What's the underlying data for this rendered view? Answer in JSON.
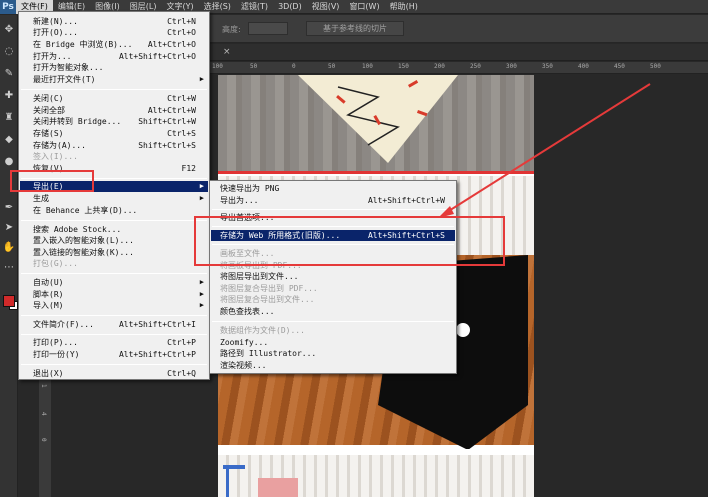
{
  "app": {
    "logo": "Ps"
  },
  "menubar": [
    {
      "label": "文件(F)",
      "active": true
    },
    {
      "label": "编辑(E)"
    },
    {
      "label": "图像(I)"
    },
    {
      "label": "图层(L)"
    },
    {
      "label": "文字(Y)"
    },
    {
      "label": "选择(S)"
    },
    {
      "label": "滤镜(T)"
    },
    {
      "label": "3D(D)"
    },
    {
      "label": "视图(V)"
    },
    {
      "label": "窗口(W)"
    },
    {
      "label": "帮助(H)"
    }
  ],
  "options": {
    "height_label": "高度:",
    "slice_button": "基于参考线的切片"
  },
  "doctab": {
    "close": "×"
  },
  "ruler_top": [
    "100",
    "50",
    "0",
    "50",
    "100",
    "150",
    "200",
    "250",
    "300",
    "350",
    "400",
    "450",
    "500"
  ],
  "ruler_left": [
    "1",
    "4",
    "0"
  ],
  "file_menu": {
    "new": {
      "label": "新建(N)...",
      "shortcut": "Ctrl+N"
    },
    "open": {
      "label": "打开(O)...",
      "shortcut": "Ctrl+O"
    },
    "bridge": {
      "label": "在 Bridge 中浏览(B)...",
      "shortcut": "Alt+Ctrl+O"
    },
    "open_as": {
      "label": "打开为...",
      "shortcut": "Alt+Shift+Ctrl+O"
    },
    "open_smart": {
      "label": "打开为智能对象..."
    },
    "recent": {
      "label": "最近打开文件(T)"
    },
    "close": {
      "label": "关闭(C)",
      "shortcut": "Ctrl+W"
    },
    "close_all": {
      "label": "关闭全部",
      "shortcut": "Alt+Ctrl+W"
    },
    "close_bridge": {
      "label": "关闭并转到 Bridge...",
      "shortcut": "Shift+Ctrl+W"
    },
    "save": {
      "label": "存储(S)",
      "shortcut": "Ctrl+S"
    },
    "save_as": {
      "label": "存储为(A)...",
      "shortcut": "Shift+Ctrl+S"
    },
    "checkin": {
      "label": "签入(I)..."
    },
    "revert": {
      "label": "恢复(V)",
      "shortcut": "F12"
    },
    "export": {
      "label": "导出(E)"
    },
    "generate": {
      "label": "生成"
    },
    "behance": {
      "label": "在 Behance 上共享(D)..."
    },
    "adobe_stock": {
      "label": "搜索 Adobe Stock..."
    },
    "place_embedded": {
      "label": "置入嵌入的智能对象(L)..."
    },
    "place_linked": {
      "label": "置入链接的智能对象(K)..."
    },
    "package": {
      "label": "打包(G)..."
    },
    "automate": {
      "label": "自动(U)"
    },
    "scripts": {
      "label": "脚本(R)"
    },
    "import": {
      "label": "导入(M)"
    },
    "file_info": {
      "label": "文件简介(F)...",
      "shortcut": "Alt+Shift+Ctrl+I"
    },
    "print": {
      "label": "打印(P)...",
      "shortcut": "Ctrl+P"
    },
    "print_one": {
      "label": "打印一份(Y)",
      "shortcut": "Alt+Shift+Ctrl+P"
    },
    "exit": {
      "label": "退出(X)",
      "shortcut": "Ctrl+Q"
    }
  },
  "export_menu": {
    "quick_png": {
      "label": "快速导出为 PNG"
    },
    "export_as": {
      "label": "导出为...",
      "shortcut": "Alt+Shift+Ctrl+W"
    },
    "export_prefs": {
      "label": "导出首选项..."
    },
    "save_web": {
      "label": "存储为 Web 所用格式(旧版)...",
      "shortcut": "Alt+Shift+Ctrl+S"
    },
    "artboards_files": {
      "label": "画板至文件..."
    },
    "artboards_pdf": {
      "label": "将画板导出到 PDF..."
    },
    "layers_files": {
      "label": "将图层导出到文件..."
    },
    "comps_pdf": {
      "label": "将图层复合导出到 PDF..."
    },
    "comps_files": {
      "label": "将图层复合导出到文件..."
    },
    "color_lookup": {
      "label": "颜色查找表..."
    },
    "data_sets": {
      "label": "数据组作为文件(D)..."
    },
    "zoomify": {
      "label": "Zoomify..."
    },
    "paths_illustrator": {
      "label": "路径到 Illustrator..."
    },
    "render_video": {
      "label": "渲染视频..."
    }
  },
  "colors": {
    "highlight": "#0a246a",
    "annotation": "#e53a3a",
    "foreground_swatch": "#d12a2a"
  }
}
